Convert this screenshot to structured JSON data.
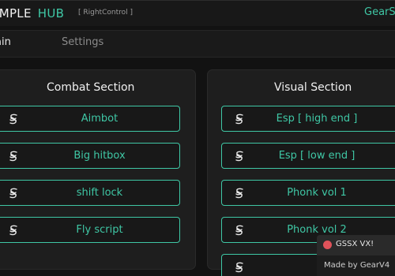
{
  "header": {
    "title_main": "IMPLE",
    "title_accent": "HUB",
    "keybind": "[ RightControl ]",
    "brand": "GearS"
  },
  "tabs": [
    {
      "label": "ain",
      "active": true
    },
    {
      "label": "Settings",
      "active": false
    }
  ],
  "combat": {
    "title": "Combat Section",
    "buttons": [
      "Aimbot",
      "Big hitbox",
      "shift lock",
      "Fly script"
    ]
  },
  "visual": {
    "title": "Visual Section",
    "buttons": [
      "Esp [ high end ]",
      "Esp [ low end ]",
      "Phonk vol 1",
      "Phonk vol 2"
    ]
  },
  "notifications": [
    {
      "text": "GSSX VX!"
    },
    {
      "text": "Made by GearV4"
    }
  ],
  "colors": {
    "accent": "#3fc7a5",
    "background": "#121212",
    "panel": "#1e1e1e",
    "notification_dot": "#e0525a"
  },
  "icons": {
    "button_icon": "swirl-s-icon",
    "notification_icon": "alert-dot-icon"
  }
}
